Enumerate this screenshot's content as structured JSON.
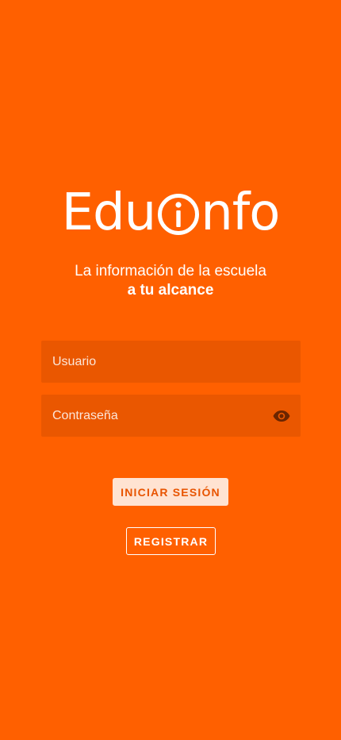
{
  "brand": {
    "name_part1": "Edu",
    "name_part2": "nfo",
    "logo_icon": "info-circle-icon"
  },
  "tagline": {
    "line1": "La información de la escuela",
    "line2": "a tu alcance"
  },
  "form": {
    "username": {
      "placeholder": "Usuario",
      "value": ""
    },
    "password": {
      "placeholder": "Contraseña",
      "value": "",
      "toggle_icon": "eye-icon"
    },
    "login_label": "INICIAR SESIÓN",
    "register_label": "REGISTRAR"
  },
  "colors": {
    "background": "#FF6000",
    "field_background": "#EA5700",
    "login_button_background": "#FFE3D2",
    "login_button_text": "#E85400",
    "eye_icon": "#6B2500"
  }
}
